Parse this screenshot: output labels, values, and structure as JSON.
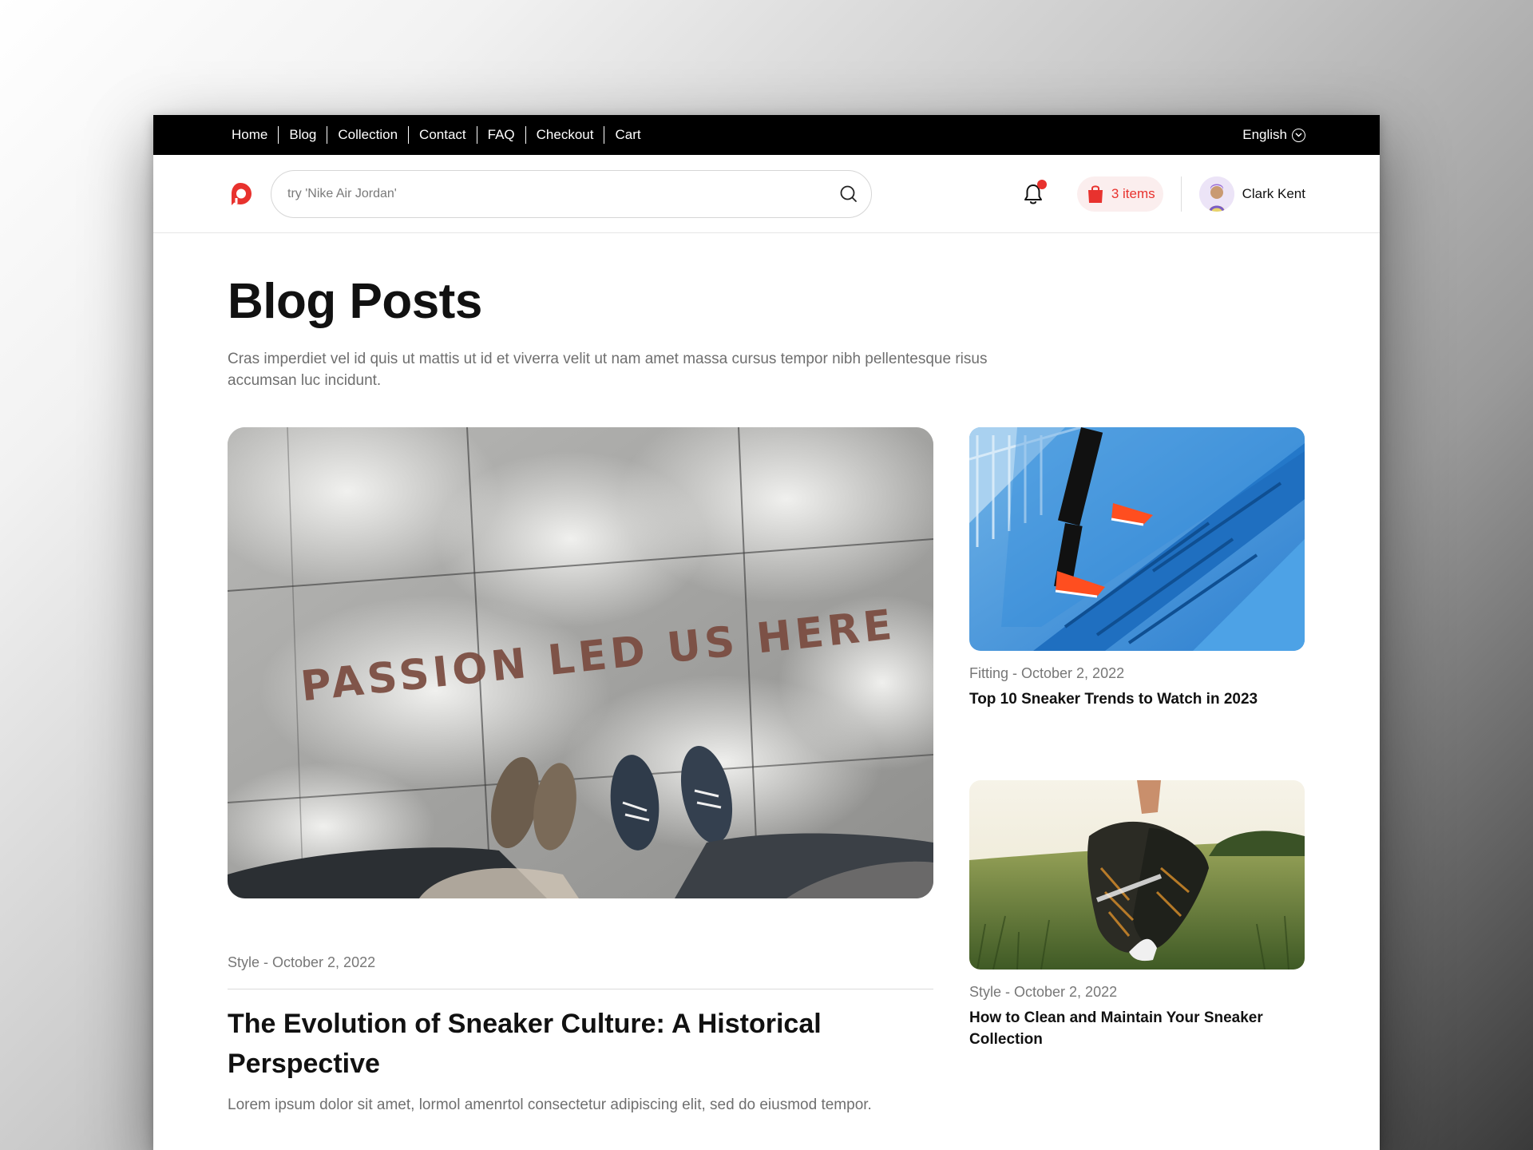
{
  "topnav": {
    "items": [
      "Home",
      "Blog",
      "Collection",
      "Contact",
      "FAQ",
      "Checkout",
      "Cart"
    ],
    "language": "English"
  },
  "header": {
    "search_placeholder": "try 'Nike Air Jordan'",
    "cart_label": "3 items",
    "user_name": "Clark Kent"
  },
  "colors": {
    "accent": "#e8322e",
    "topbar": "#000000"
  },
  "icons": [
    "logo-icon",
    "search-icon",
    "bell-icon",
    "shopping-bag-icon",
    "chevron-down-icon",
    "avatar"
  ],
  "page": {
    "title": "Blog Posts",
    "description": "Cras imperdiet vel id quis ut mattis ut id et viverra velit ut nam amet massa cursus tempor nibh pellentesque risus accumsan luc incidunt."
  },
  "featured_post": {
    "image_text": "PASSION LED US HERE",
    "meta": "Style - October 2, 2022",
    "title": "The Evolution of Sneaker Culture: A Historical Perspective",
    "excerpt": "Lorem ipsum dolor sit amet, lormol amenrtol consectetur adipiscing elit, sed do eiusmod tempor."
  },
  "side_posts": [
    {
      "meta": "Fitting - October 2, 2022",
      "title": "Top 10 Sneaker Trends to Watch in 2023"
    },
    {
      "meta": "Style - October 2, 2022",
      "title": "How to Clean and Maintain Your Sneaker Collection"
    }
  ]
}
